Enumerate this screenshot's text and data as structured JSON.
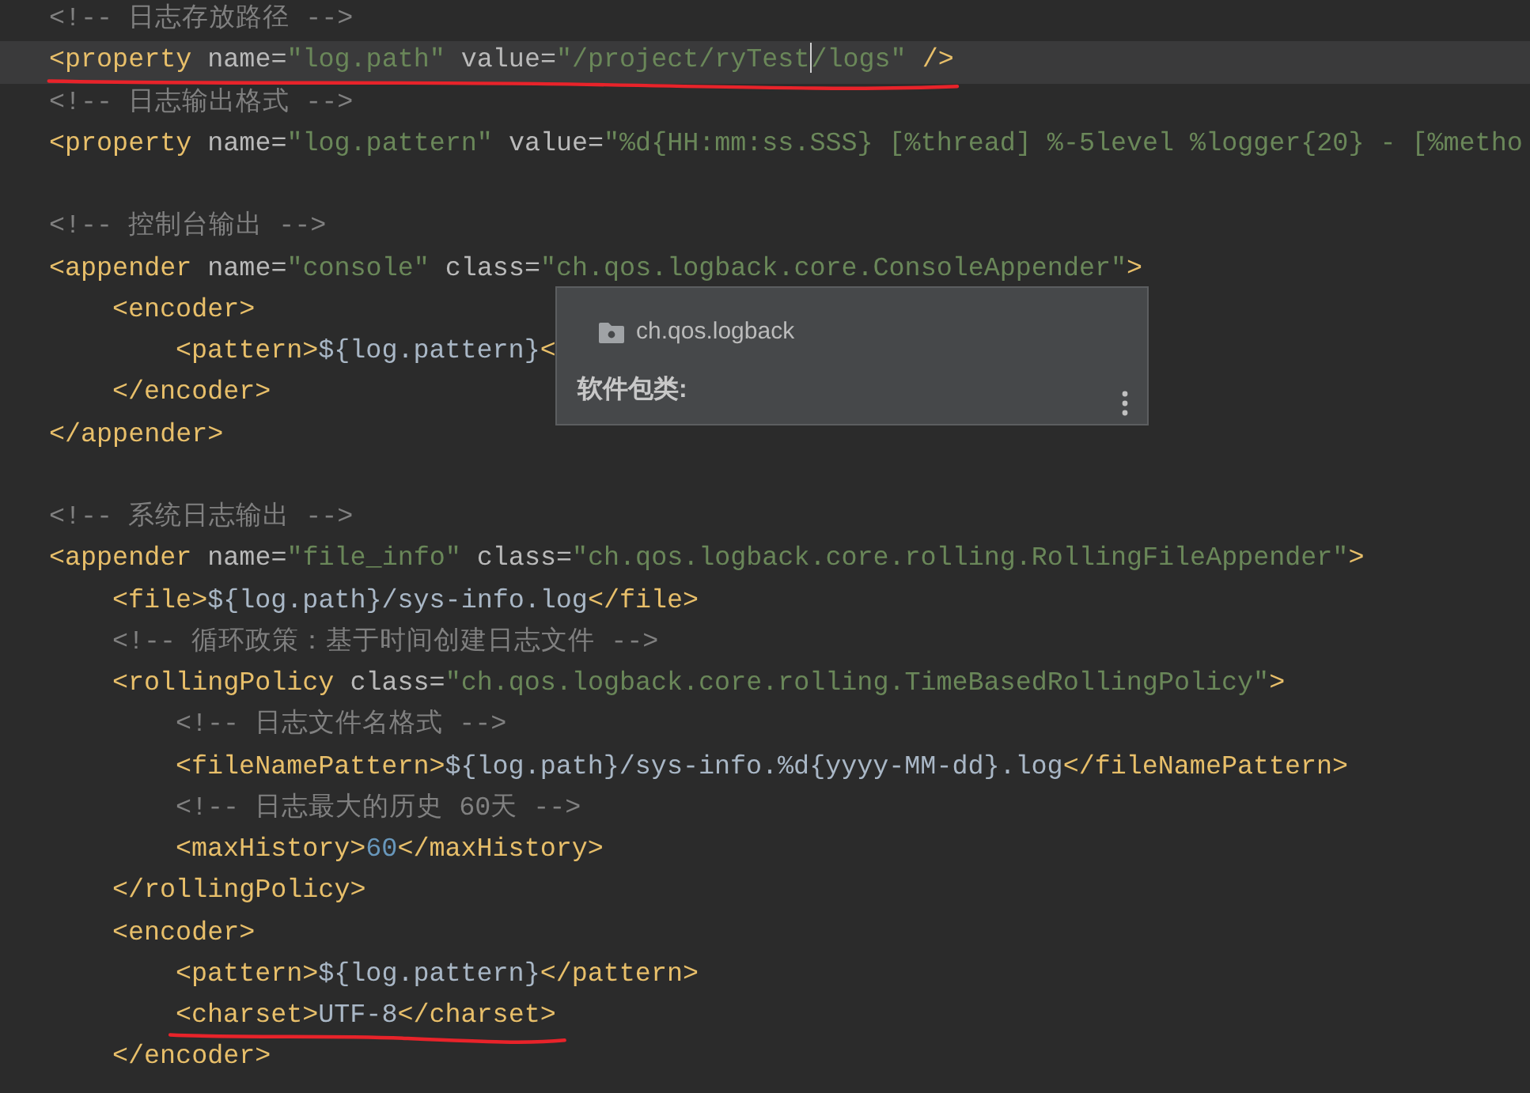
{
  "editor": {
    "lines": [
      {
        "current": false,
        "underlined": false,
        "tokens": [
          {
            "kind": "comment",
            "text": "<!-- 日志存放路径 -->"
          }
        ]
      },
      {
        "current": true,
        "underlined": true,
        "tokens": [
          {
            "kind": "tag",
            "text": "<property "
          },
          {
            "kind": "attr",
            "text": "name="
          },
          {
            "kind": "string",
            "text": "\"log.path\" "
          },
          {
            "kind": "attr",
            "text": "value="
          },
          {
            "kind": "string",
            "text": "\"/project/ryTest"
          },
          {
            "kind": "caret"
          },
          {
            "kind": "string",
            "text": "/logs\" "
          },
          {
            "kind": "tag",
            "text": "/>"
          }
        ]
      },
      {
        "current": false,
        "underlined": false,
        "tokens": [
          {
            "kind": "comment",
            "text": "<!-- 日志输出格式 -->"
          }
        ]
      },
      {
        "current": false,
        "underlined": false,
        "tokens": [
          {
            "kind": "tag",
            "text": "<property "
          },
          {
            "kind": "attr",
            "text": "name="
          },
          {
            "kind": "string",
            "text": "\"log.pattern\" "
          },
          {
            "kind": "attr",
            "text": "value="
          },
          {
            "kind": "string",
            "text": "\"%d{HH:mm:ss.SSS} [%thread] %-5level %logger{20} - [%metho"
          }
        ]
      },
      {
        "current": false,
        "underlined": false
      },
      {
        "current": false,
        "underlined": false,
        "tokens": [
          {
            "kind": "comment",
            "text": "<!-- 控制台输出 -->"
          }
        ]
      },
      {
        "current": false,
        "underlined": false,
        "tokens": [
          {
            "kind": "tag",
            "text": "<appender "
          },
          {
            "kind": "attr",
            "text": "name="
          },
          {
            "kind": "string",
            "text": "\"console\" "
          },
          {
            "kind": "attr",
            "text": "class="
          },
          {
            "kind": "string",
            "text": "\"ch.qos.logback.core.ConsoleAppender\""
          },
          {
            "kind": "tag",
            "text": ">"
          }
        ],
        "children": [
          {
            "current": false,
            "underlined": false,
            "tokens": [
              {
                "kind": "tag",
                "text": "<encoder>"
              }
            ],
            "children": [
              {
                "current": false,
                "underlined": false,
                "tokens": [
                  {
                    "kind": "tag",
                    "text": "<pattern>"
                  },
                  {
                    "kind": "text",
                    "text": "${log.pattern}"
                  },
                  {
                    "kind": "tag",
                    "text": "<"
                  }
                ]
              }
            ]
          },
          {
            "current": false,
            "underlined": false,
            "tokens": [
              {
                "kind": "tag",
                "text": "</encoder>"
              }
            ]
          }
        ]
      },
      {
        "current": false,
        "underlined": false,
        "tokens": [
          {
            "kind": "tag",
            "text": "</appender>"
          }
        ]
      },
      {
        "current": false,
        "underlined": false
      },
      {
        "current": false,
        "underlined": false,
        "tokens": [
          {
            "kind": "comment",
            "text": "<!-- 系统日志输出 -->"
          }
        ]
      },
      {
        "current": false,
        "underlined": false,
        "tokens": [
          {
            "kind": "tag",
            "text": "<appender "
          },
          {
            "kind": "attr",
            "text": "name="
          },
          {
            "kind": "string",
            "text": "\"file_info\" "
          },
          {
            "kind": "attr",
            "text": "class="
          },
          {
            "kind": "string",
            "text": "\"ch.qos.logback.core.rolling.RollingFileAppender\""
          },
          {
            "kind": "tag",
            "text": ">"
          }
        ],
        "children": [
          {
            "current": false,
            "underlined": false,
            "tokens": [
              {
                "kind": "tag",
                "text": "<file>"
              },
              {
                "kind": "text",
                "text": "${log.path}/sys-info.log"
              },
              {
                "kind": "tag",
                "text": "</file>"
              }
            ]
          },
          {
            "current": false,
            "underlined": false,
            "tokens": [
              {
                "kind": "comment",
                "text": "<!-- 循环政策：基于时间创建日志文件 -->"
              }
            ]
          },
          {
            "current": false,
            "underlined": false,
            "tokens": [
              {
                "kind": "tag",
                "text": "<rollingPolicy "
              },
              {
                "kind": "attr",
                "text": "class="
              },
              {
                "kind": "string",
                "text": "\"ch.qos.logback.core.rolling.TimeBasedRollingPolicy\""
              },
              {
                "kind": "tag",
                "text": ">"
              }
            ],
            "children": [
              {
                "current": false,
                "underlined": false,
                "tokens": [
                  {
                    "kind": "comment",
                    "text": "<!-- 日志文件名格式 -->"
                  }
                ]
              },
              {
                "current": false,
                "underlined": false,
                "tokens": [
                  {
                    "kind": "tag",
                    "text": "<fileNamePattern>"
                  },
                  {
                    "kind": "text",
                    "text": "${log.path}/sys-info.%d{yyyy-MM-dd}.log"
                  },
                  {
                    "kind": "tag",
                    "text": "</fileNamePattern>"
                  }
                ]
              },
              {
                "current": false,
                "underlined": false,
                "tokens": [
                  {
                    "kind": "comment",
                    "text": "<!-- 日志最大的历史 60天 -->"
                  }
                ]
              },
              {
                "current": false,
                "underlined": false,
                "tokens": [
                  {
                    "kind": "tag",
                    "text": "<maxHistory>"
                  },
                  {
                    "kind": "number",
                    "text": "60"
                  },
                  {
                    "kind": "tag",
                    "text": "</maxHistory>"
                  }
                ]
              }
            ]
          },
          {
            "current": false,
            "underlined": false,
            "tokens": [
              {
                "kind": "tag",
                "text": "</rollingPolicy>"
              }
            ]
          },
          {
            "current": false,
            "underlined": false,
            "tokens": [
              {
                "kind": "tag",
                "text": "<encoder>"
              }
            ],
            "children": [
              {
                "current": false,
                "underlined": false,
                "tokens": [
                  {
                    "kind": "tag",
                    "text": "<pattern>"
                  },
                  {
                    "kind": "text",
                    "text": "${log.pattern}"
                  },
                  {
                    "kind": "tag",
                    "text": "</pattern>"
                  }
                ]
              },
              {
                "current": false,
                "underlined": true,
                "tokens": [
                  {
                    "kind": "tag",
                    "text": "<charset>"
                  },
                  {
                    "kind": "text",
                    "text": "UTF-8"
                  },
                  {
                    "kind": "tag",
                    "text": "</charset>"
                  }
                ]
              }
            ]
          },
          {
            "current": false,
            "underlined": false,
            "tokens": [
              {
                "kind": "tag",
                "text": "</encoder>"
              }
            ]
          }
        ]
      }
    ]
  },
  "popup": {
    "package": "ch.qos.logback",
    "label": "软件包类:"
  }
}
